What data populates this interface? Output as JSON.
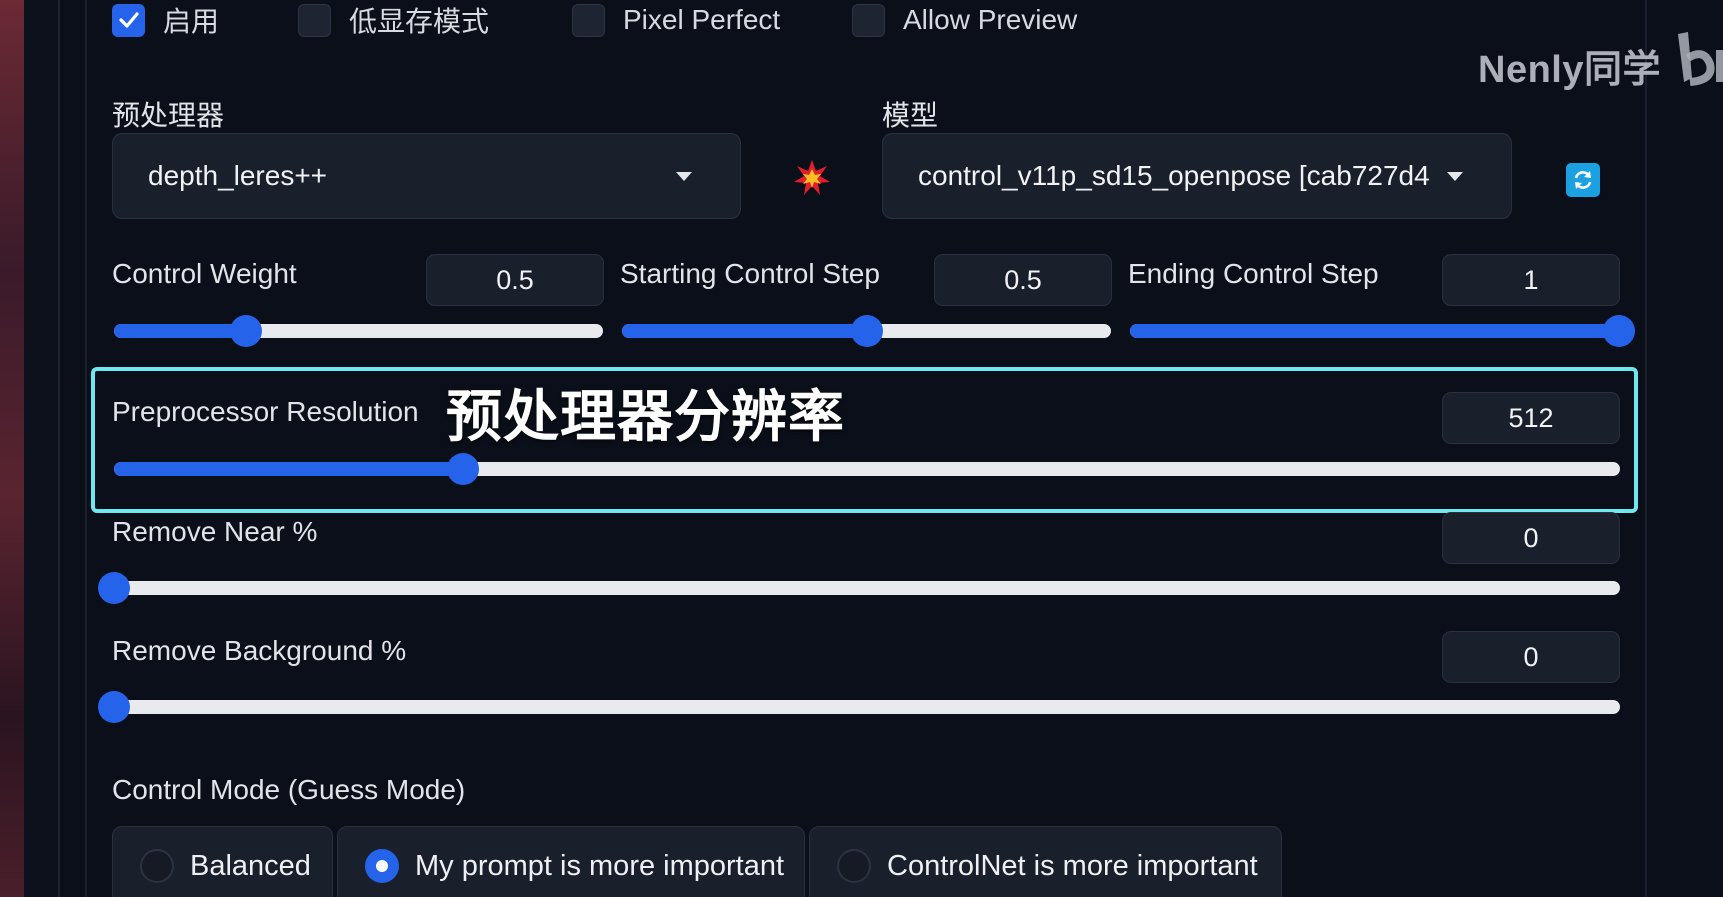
{
  "watermark": {
    "text": "Nenly同学",
    "logo": "bili"
  },
  "toggles": [
    {
      "label": "启用",
      "checked": true
    },
    {
      "label": "低显存模式",
      "checked": false
    },
    {
      "label": "Pixel Perfect",
      "checked": false
    },
    {
      "label": "Allow Preview",
      "checked": false
    }
  ],
  "preprocessor": {
    "label": "预处理器",
    "value": "depth_leres++",
    "icon": "explosion-icon"
  },
  "model": {
    "label": "模型",
    "value": "control_v11p_sd15_openpose [cab727d4",
    "refresh_icon": "refresh-icon"
  },
  "sliders": {
    "control_weight": {
      "label": "Control Weight",
      "value": "0.5",
      "fraction": 0.27
    },
    "starting_step": {
      "label": "Starting Control Step",
      "value": "0.5",
      "fraction": 0.5
    },
    "ending_step": {
      "label": "Ending Control Step",
      "value": "1",
      "fraction": 1.0
    },
    "preprocessor_resolution": {
      "label": "Preprocessor Resolution",
      "value": "512",
      "fraction": 0.232,
      "caption": "预处理器分辨率"
    },
    "remove_near": {
      "label": "Remove Near %",
      "value": "0",
      "fraction": 0.0
    },
    "remove_background": {
      "label": "Remove Background %",
      "value": "0",
      "fraction": 0.0
    }
  },
  "control_mode": {
    "label": "Control Mode (Guess Mode)",
    "options": [
      {
        "label": "Balanced",
        "selected": false
      },
      {
        "label": "My prompt is more important",
        "selected": true
      },
      {
        "label": "ControlNet is more important",
        "selected": false
      }
    ]
  },
  "colors": {
    "accent": "#2563eb",
    "highlight": "#6ee8ec",
    "background": "#0b0f19"
  }
}
